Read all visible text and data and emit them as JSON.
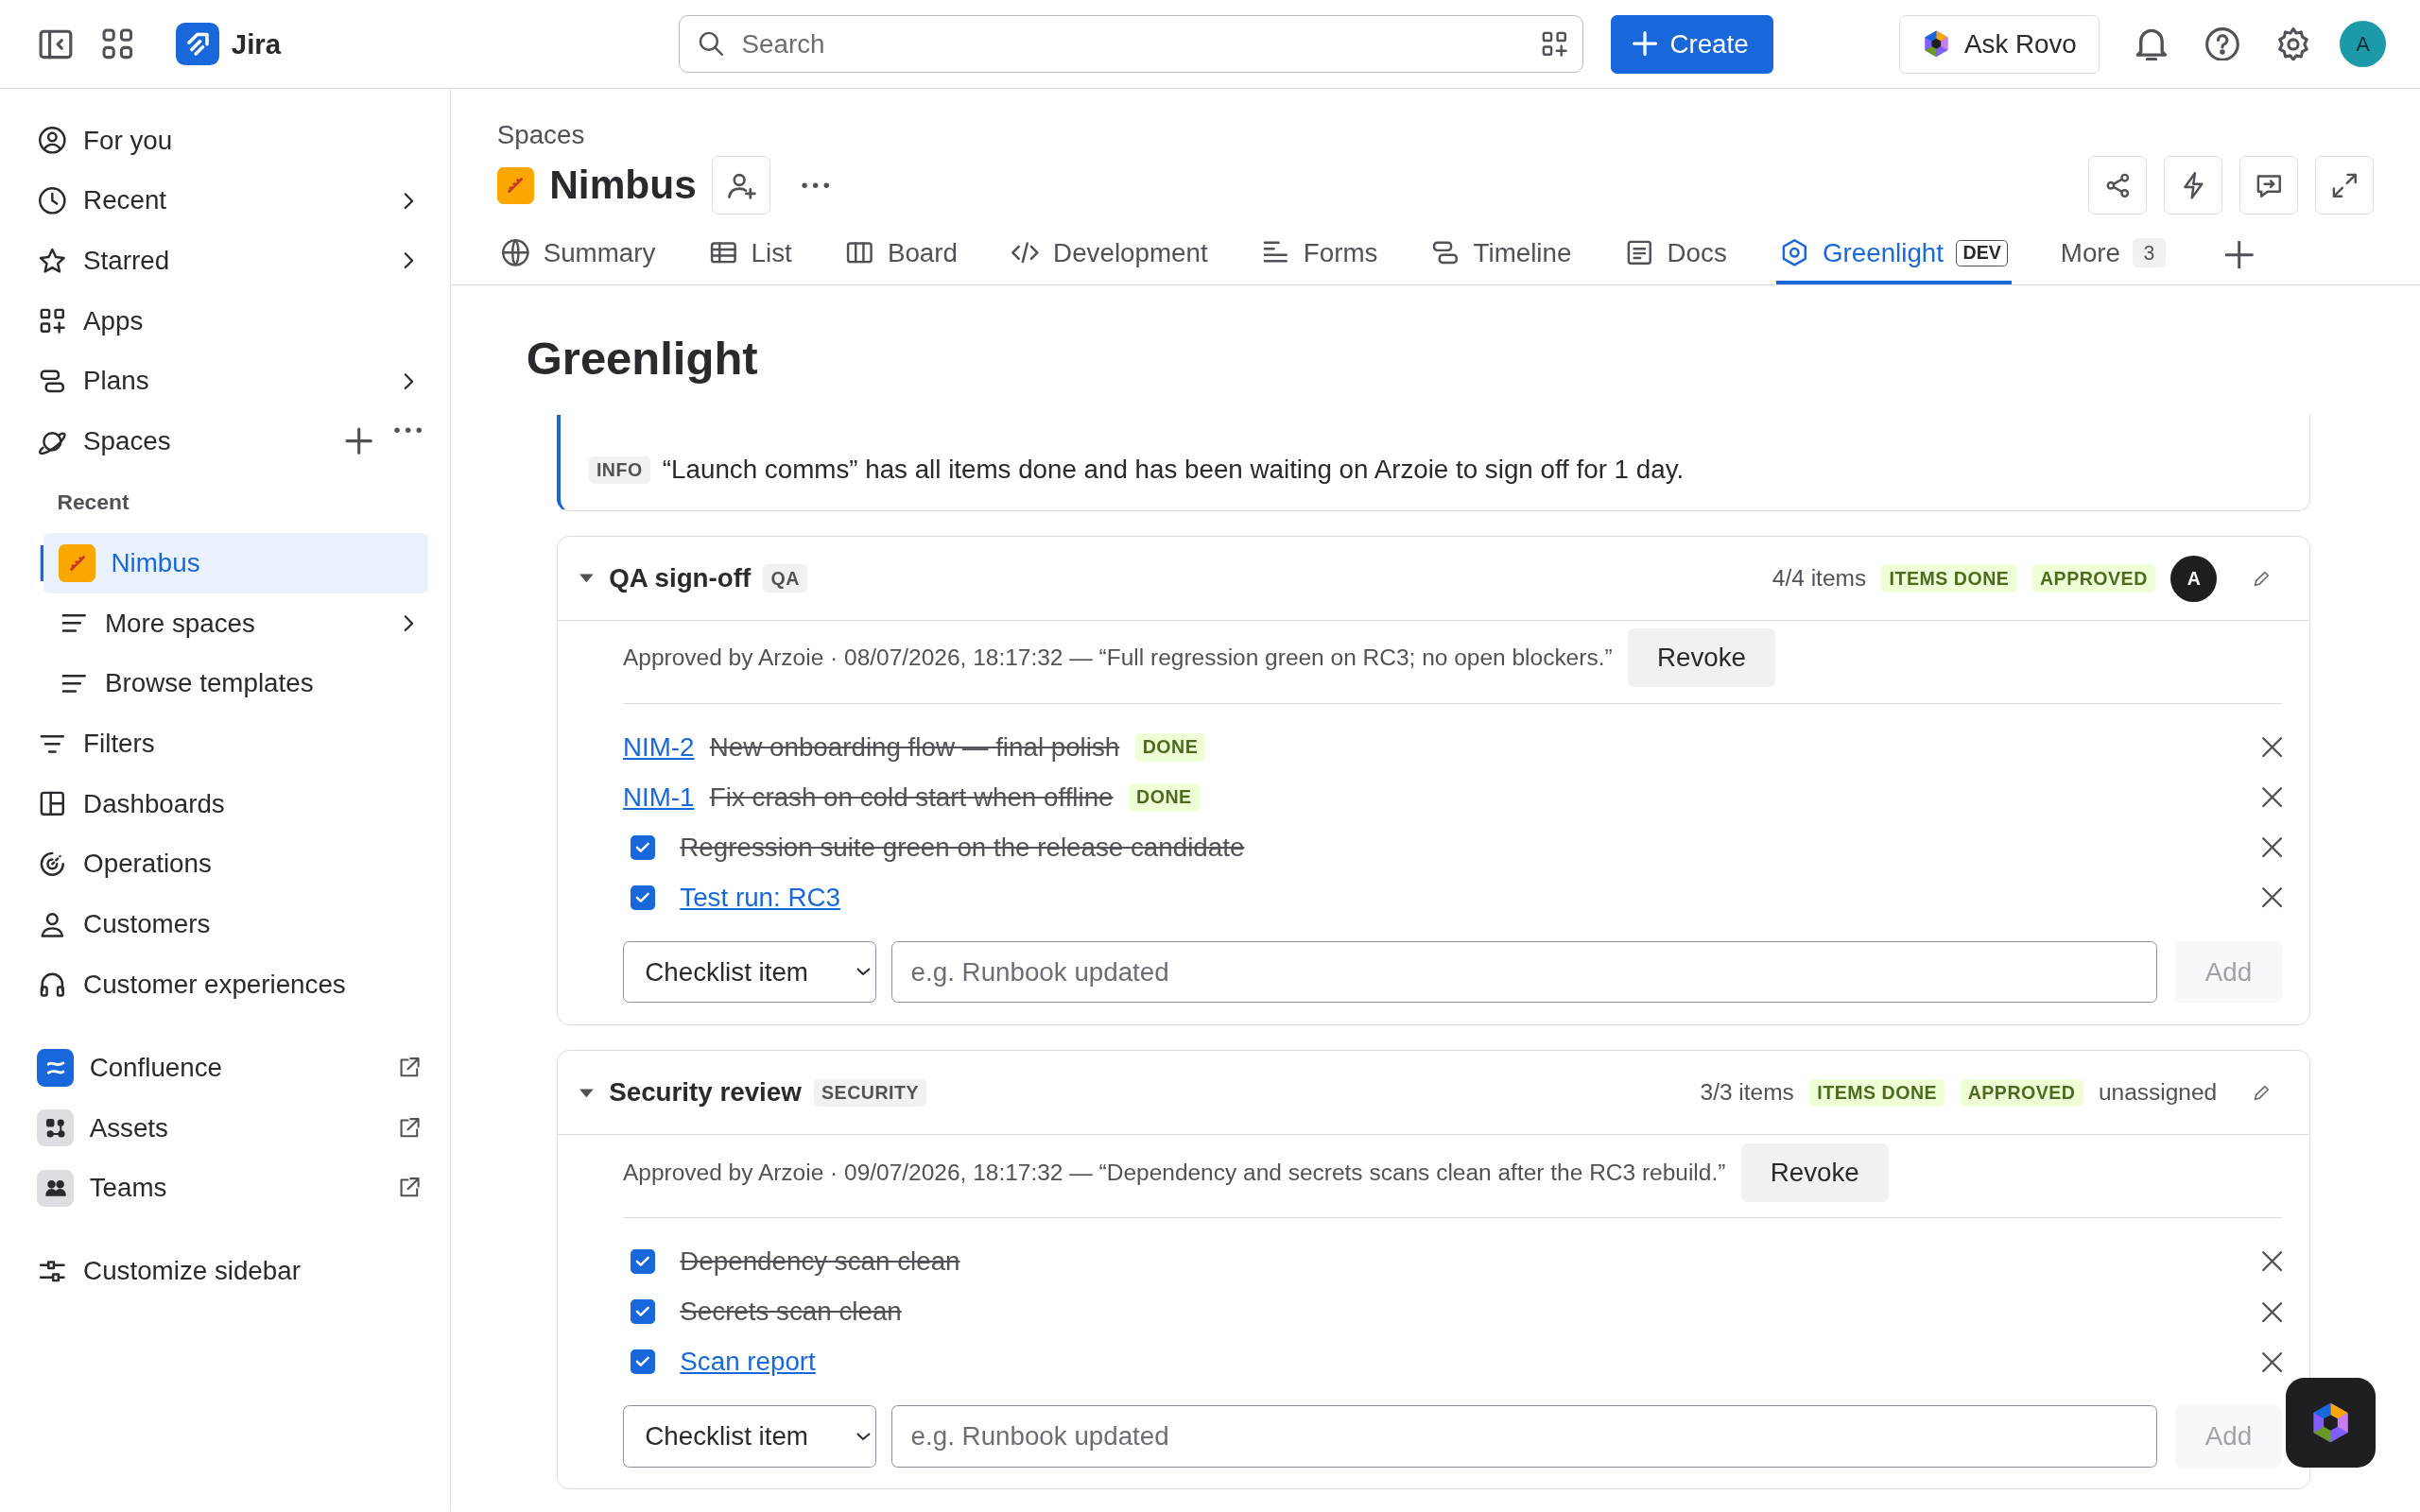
{
  "topbar": {
    "app_name": "Jira",
    "search": {
      "placeholder": "Search"
    },
    "create_button": "Create",
    "ask_button": "Ask Rovo",
    "avatar": "A"
  },
  "nav": [
    {
      "kind": "item",
      "label": "For you",
      "chevron": false,
      "selected": false
    },
    {
      "kind": "item",
      "label": "Recent",
      "chevron": true,
      "selected": false
    },
    {
      "kind": "item",
      "label": "Starred",
      "chevron": true,
      "selected": false
    },
    {
      "kind": "item",
      "label": "Apps",
      "chevron": false,
      "selected": false
    },
    {
      "kind": "item",
      "label": "Plans",
      "chevron": true,
      "selected": false
    },
    {
      "kind": "spaces",
      "label": "Spaces",
      "chevron": false,
      "selected": false
    },
    {
      "kind": "section",
      "label": "Recent"
    },
    {
      "kind": "space",
      "label": "Nimbus",
      "chevron": false,
      "selected": true
    },
    {
      "kind": "sub",
      "label": "More spaces",
      "chevron": true,
      "selected": false
    },
    {
      "kind": "sub",
      "label": "Browse templates",
      "chevron": false,
      "selected": false
    },
    {
      "kind": "item",
      "label": "Filters",
      "chevron": false,
      "selected": false
    },
    {
      "kind": "item",
      "label": "Dashboards",
      "chevron": false,
      "selected": false
    },
    {
      "kind": "item",
      "label": "Operations",
      "chevron": false,
      "selected": false
    },
    {
      "kind": "item",
      "label": "Customers",
      "chevron": false,
      "selected": false
    },
    {
      "kind": "item",
      "label": "Customer experiences",
      "chevron": false,
      "selected": false
    },
    {
      "kind": "app",
      "label": "Confluence",
      "chevron": false,
      "selected": false
    },
    {
      "kind": "app",
      "label": "Assets",
      "chevron": false,
      "selected": false
    },
    {
      "kind": "app",
      "label": "Teams",
      "chevron": false,
      "selected": false
    },
    {
      "kind": "footer",
      "label": "Customize sidebar",
      "chevron": false,
      "selected": false
    }
  ],
  "header": {
    "breadcrumb": "Spaces",
    "space_name": "Nimbus",
    "tabs": [
      {
        "label": "Summary",
        "selected": false
      },
      {
        "label": "List",
        "selected": false
      },
      {
        "label": "Board",
        "selected": false
      },
      {
        "label": "Development",
        "selected": false
      },
      {
        "label": "Forms",
        "selected": false
      },
      {
        "label": "Timeline",
        "selected": false
      },
      {
        "label": "Docs",
        "selected": false
      },
      {
        "label": "Greenlight",
        "selected": true,
        "badge": "DEV"
      },
      {
        "label": "More",
        "selected": false,
        "count": "3"
      }
    ]
  },
  "page": {
    "title": "Greenlight",
    "notices": [
      {
        "tag": "INFO",
        "text": "“Launch comms” has all items done and has been waiting on Arzoie to sign off for 1 day."
      }
    ],
    "cards": [
      {
        "title": "QA sign-off",
        "tag": "QA",
        "expanded": true,
        "count": "4/4 items",
        "badges": [
          "ITEMS DONE",
          "APPROVED"
        ],
        "assignee": {
          "kind": "avatar",
          "text": "A"
        },
        "approval": "Approved by Arzoie · 08/07/2026, 18:17:32 — “Full regression green on RC3; no open blockers.”",
        "revoke": "Revoke",
        "items": [
          {
            "kind": "issue",
            "key": "NIM-2",
            "text": "New onboarding flow — final polish",
            "status": "DONE",
            "done": true
          },
          {
            "kind": "issue",
            "key": "NIM-1",
            "text": "Fix crash on cold start when offline",
            "status": "DONE",
            "done": true
          },
          {
            "kind": "check",
            "text": "Regression suite green on the release candidate",
            "checked": true,
            "link": false
          },
          {
            "kind": "check",
            "text": "Test run: RC3",
            "checked": true,
            "link": true
          }
        ],
        "add_row": {
          "select": "Checklist item",
          "placeholder": "e.g. Runbook updated",
          "button": "Add",
          "disabled": true
        }
      },
      {
        "title": "Security review",
        "tag": "SECURITY",
        "expanded": true,
        "count": "3/3 items",
        "badges": [
          "ITEMS DONE",
          "APPROVED"
        ],
        "assignee": {
          "kind": "text",
          "text": "unassigned"
        },
        "approval": "Approved by Arzoie · 09/07/2026, 18:17:32 — “Dependency and secrets scans clean after the RC3 rebuild.”",
        "revoke": "Revoke",
        "items": [
          {
            "kind": "check",
            "text": "Dependency scan clean",
            "checked": true,
            "link": false
          },
          {
            "kind": "check",
            "text": "Secrets scan clean",
            "checked": true,
            "link": false
          },
          {
            "kind": "check",
            "text": "Scan report",
            "checked": true,
            "link": true
          }
        ],
        "add_row": {
          "select": "Checklist item",
          "placeholder": "e.g. Runbook updated",
          "button": "Add",
          "disabled": true
        }
      }
    ]
  }
}
